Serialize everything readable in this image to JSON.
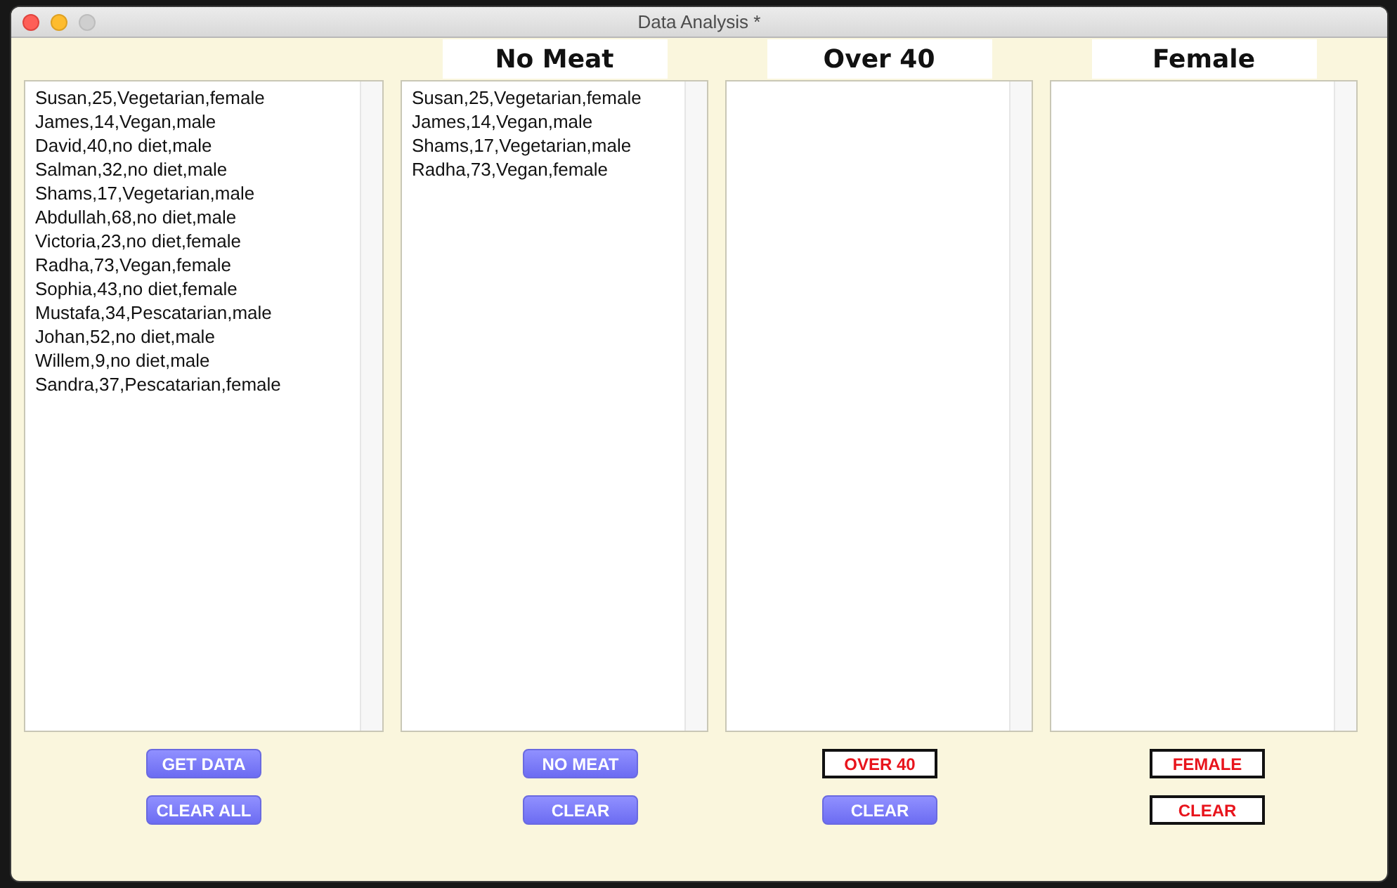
{
  "window": {
    "title": "Data Analysis *",
    "controls": [
      {
        "kind": "close",
        "disabled": false
      },
      {
        "kind": "minimize",
        "disabled": false
      },
      {
        "kind": "zoom",
        "disabled": true
      }
    ]
  },
  "lists": [
    {
      "items": [
        "Susan,25,Vegetarian,female",
        "James,14,Vegan,male",
        "David,40,no diet,male",
        "Salman,32,no diet,male",
        "Shams,17,Vegetarian,male",
        "Abdullah,68,no diet,male",
        "Victoria,23,no diet,female",
        "Radha,73,Vegan,female",
        "Sophia,43,no diet,female",
        "Mustafa,34,Pescatarian,male",
        "Johan,52,no diet,male",
        "Willem,9,no diet,male",
        "Sandra,37,Pescatarian,female"
      ]
    },
    {
      "heading": "No Meat",
      "items": [
        "Susan,25,Vegetarian,female",
        "James,14,Vegan,male",
        "Shams,17,Vegetarian,male",
        "Radha,73,Vegan,female"
      ]
    },
    {
      "heading": "Over 40"
    },
    {
      "heading": "Female"
    }
  ],
  "button_rows": [
    [
      {
        "label": "GET DATA",
        "kind": "filled"
      },
      {
        "label": "NO MEAT",
        "kind": "filled"
      },
      {
        "label": "OVER 40",
        "kind": "outlined"
      },
      {
        "label": "FEMALE",
        "kind": "outlined"
      }
    ],
    [
      {
        "label": "CLEAR ALL",
        "kind": "filled"
      },
      {
        "label": "CLEAR",
        "kind": "filled"
      },
      {
        "label": "CLEAR",
        "kind": "filled"
      },
      {
        "label": "CLEAR",
        "kind": "outlined"
      }
    ]
  ]
}
